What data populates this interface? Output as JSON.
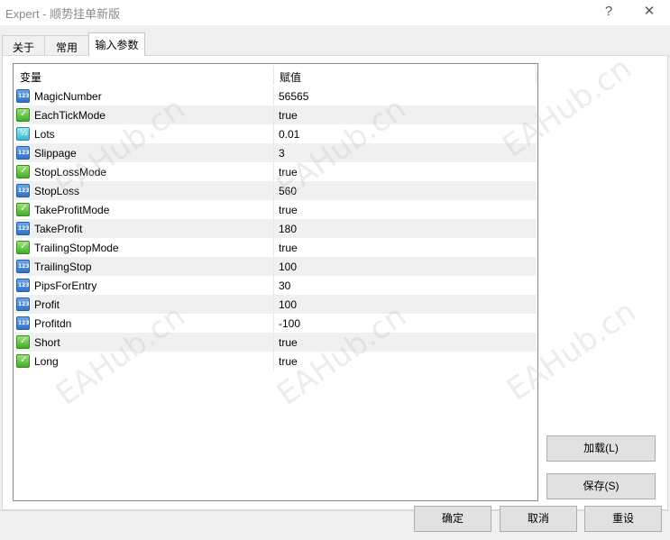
{
  "window": {
    "title": "Expert - 顺势挂单新版",
    "help_label": "?",
    "close_label": "✕"
  },
  "tabs": [
    {
      "label": "关于",
      "active": false
    },
    {
      "label": "常用",
      "active": false
    },
    {
      "label": "输入参数",
      "active": true
    }
  ],
  "table": {
    "headers": {
      "variable": "变量",
      "value": "赋值"
    },
    "rows": [
      {
        "icon": "int-type-icon",
        "name": "MagicNumber",
        "value": "56565"
      },
      {
        "icon": "bool-type-icon",
        "name": "EachTickMode",
        "value": "true"
      },
      {
        "icon": "double-type-icon",
        "name": "Lots",
        "value": "0.01"
      },
      {
        "icon": "int-type-icon",
        "name": "Slippage",
        "value": "3"
      },
      {
        "icon": "bool-type-icon",
        "name": "StopLossMode",
        "value": "true"
      },
      {
        "icon": "int-type-icon",
        "name": "StopLoss",
        "value": "560"
      },
      {
        "icon": "bool-type-icon",
        "name": "TakeProfitMode",
        "value": "true"
      },
      {
        "icon": "int-type-icon",
        "name": "TakeProfit",
        "value": "180"
      },
      {
        "icon": "bool-type-icon",
        "name": "TrailingStopMode",
        "value": "true"
      },
      {
        "icon": "int-type-icon",
        "name": "TrailingStop",
        "value": "100"
      },
      {
        "icon": "int-type-icon",
        "name": "PipsForEntry",
        "value": "30"
      },
      {
        "icon": "int-type-icon",
        "name": "Profit",
        "value": "100"
      },
      {
        "icon": "int-type-icon",
        "name": "Profitdn",
        "value": "-100"
      },
      {
        "icon": "bool-type-icon",
        "name": "Short",
        "value": "true"
      },
      {
        "icon": "bool-type-icon",
        "name": "Long",
        "value": "true"
      }
    ]
  },
  "side_buttons": {
    "load": "加载(L)",
    "save": "保存(S)"
  },
  "footer_buttons": {
    "ok": "确定",
    "cancel": "取消",
    "reset": "重设"
  },
  "watermark": "EAHub.cn"
}
